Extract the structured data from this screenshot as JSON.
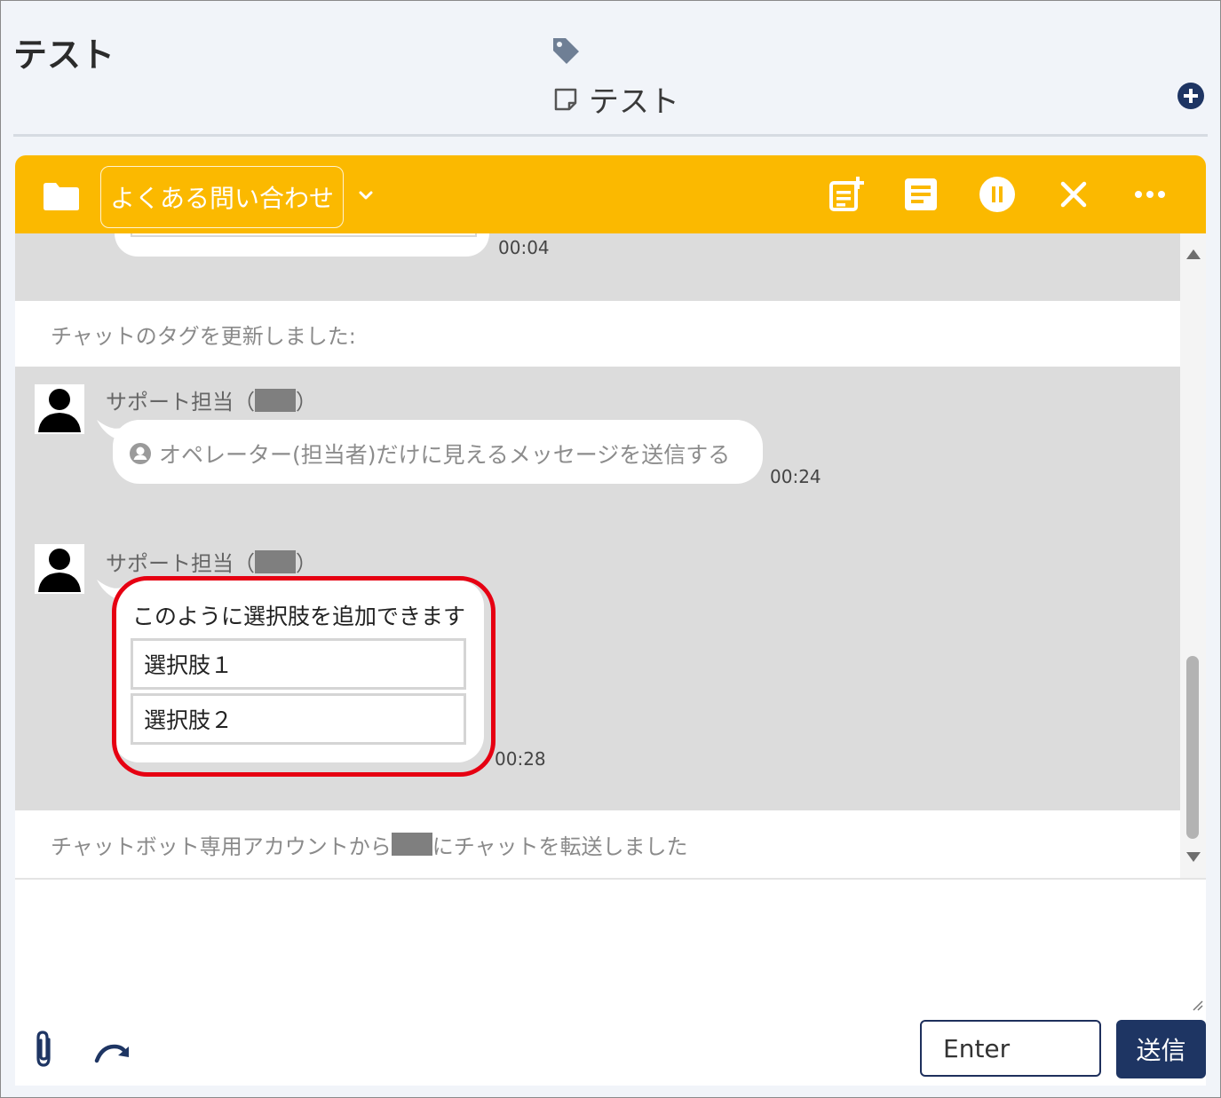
{
  "header": {
    "title": "テスト",
    "tag_label": "テスト"
  },
  "toolbar": {
    "category_label": "よくある問い合わせ"
  },
  "messages": {
    "prev_time": "00:04",
    "system_1": "チャットのタグを更新しました:",
    "msg1": {
      "sender": "サポート担当（",
      "sender_close": "）",
      "text": "オペレーター(担当者)だけに見えるメッセージを送信する",
      "time": "00:24"
    },
    "msg2": {
      "sender": "サポート担当（",
      "sender_close": "）",
      "text": "このように選択肢を追加できます",
      "choices": [
        "選択肢１",
        "選択肢２"
      ],
      "time": "00:28"
    },
    "system_2_before": "チャットボット専用アカウントから",
    "system_2_after": "にチャットを転送しました"
  },
  "input": {
    "enter_mode": "Enter",
    "send_label": "送信"
  },
  "colors": {
    "toolbar": "#fbb900",
    "send_button": "#1e3563",
    "highlight": "#e60012"
  }
}
